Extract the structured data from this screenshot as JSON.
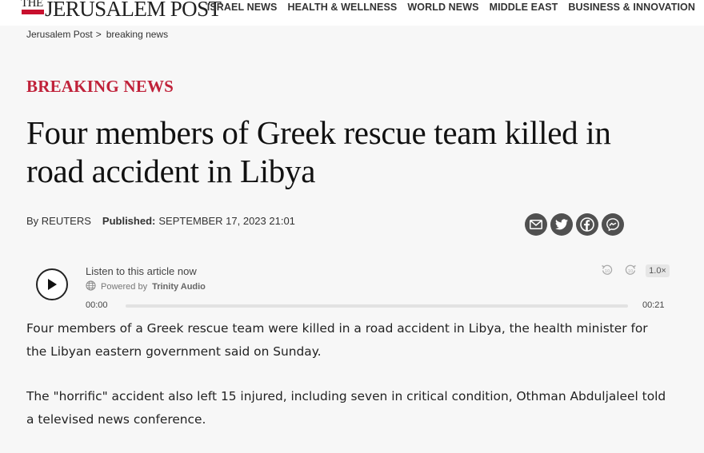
{
  "header": {
    "logo_the": "THE",
    "logo_name": "JERUSALEM POST",
    "nav": [
      "ISRAEL NEWS",
      "HEALTH & WELLNESS",
      "WORLD NEWS",
      "MIDDLE EAST",
      "BUSINESS & INNOVATION"
    ]
  },
  "breadcrumb": {
    "home": "Jerusalem Post",
    "separator": ">",
    "current": "breaking news"
  },
  "article": {
    "category": "BREAKING NEWS",
    "headline": "Four members of Greek rescue team killed in road accident in Libya",
    "byline": "By REUTERS",
    "published_label": "Published:",
    "published_date": "SEPTEMBER 17, 2023 21:01",
    "paragraphs": [
      "Four members of a Greek rescue team were killed in a road accident in Libya, the health minister for the Libyan eastern government said on Sunday.",
      "The \"horrific\" accident also left 15 injured, including seven in critical condition, Othman Abduljaleel told a televised news conference."
    ]
  },
  "share": {
    "icons": [
      "email-icon",
      "twitter-icon",
      "facebook-icon",
      "messenger-icon"
    ],
    "color": "#505050"
  },
  "player": {
    "listen_label": "Listen to this article now",
    "powered_by": "Powered by",
    "brand": "Trinity Audio",
    "speed": "1.0×",
    "time_current": "00:00",
    "time_total": "00:21",
    "progress": 0
  },
  "colors": {
    "accent": "#c0223a",
    "logo_red": "#c8102e",
    "background": "#f7f7f7"
  }
}
